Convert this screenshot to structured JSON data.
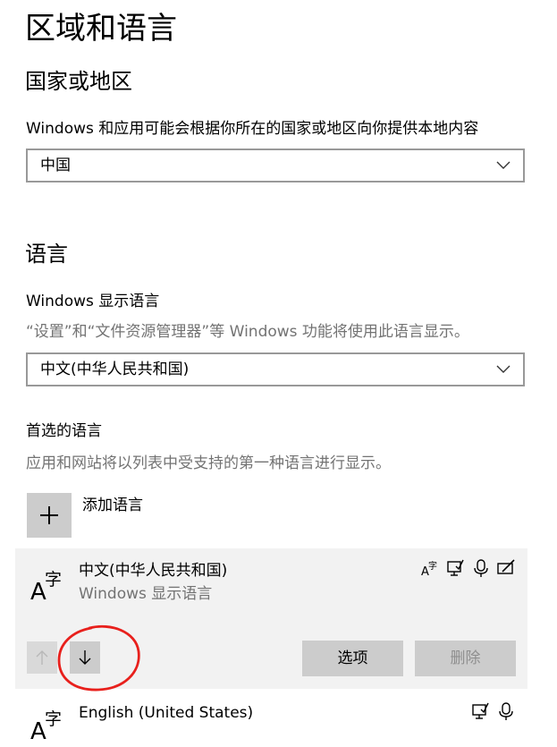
{
  "page": {
    "title": "区域和语言"
  },
  "region": {
    "heading": "国家或地区",
    "description": "Windows 和应用可能会根据你所在的国家或地区向你提供本地内容",
    "selected": "中国"
  },
  "language": {
    "heading": "语言",
    "display_label": "Windows 显示语言",
    "display_description": "“设置”和“文件资源管理器”等 Windows 功能将使用此语言显示。",
    "display_selected": "中文(中华人民共和国)",
    "preferred_heading": "首选的语言",
    "preferred_description": "应用和网站将以列表中受支持的第一种语言进行显示。",
    "add_label": "添加语言",
    "items": [
      {
        "name": "中文(中华人民共和国)",
        "subtitle": "Windows 显示语言",
        "features": [
          "language-pack-icon",
          "display-text-icon",
          "speech-icon",
          "handwriting-icon"
        ]
      },
      {
        "name": "English (United States)",
        "features": [
          "display-text-icon",
          "speech-icon"
        ]
      }
    ],
    "options_label": "选项",
    "remove_label": "删除"
  },
  "annotation": {
    "color": "#e8201c",
    "target": "move-down-button"
  },
  "colors": {
    "card_background": "#f2f2f2",
    "button_background": "#cccccc",
    "secondary_text": "#737373",
    "border": "#999999"
  }
}
